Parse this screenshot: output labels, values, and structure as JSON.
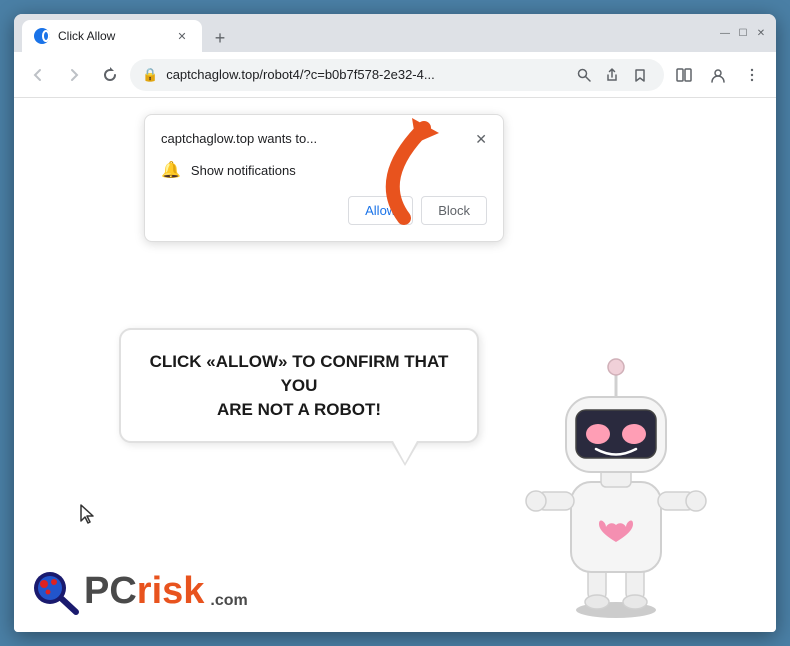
{
  "browser": {
    "tab": {
      "title": "Click Allow",
      "favicon": "globe"
    },
    "new_tab_label": "+",
    "window_controls": {
      "minimize": "—",
      "maximize": "☐",
      "close": "✕"
    },
    "nav": {
      "back_label": "←",
      "forward_label": "→",
      "reload_label": "↺",
      "address": "captchaglow.top/robot4/?c=b0b7f578-2e32-4...",
      "search_icon": "🔍",
      "share_icon": "⎙",
      "bookmark_icon": "☆",
      "split_icon": "▣",
      "profile_icon": "👤",
      "menu_icon": "⋮"
    },
    "notification_popup": {
      "title": "captchaglow.top wants to...",
      "close_label": "✕",
      "notification_text": "Show notifications",
      "allow_label": "Allow",
      "block_label": "Block"
    }
  },
  "page": {
    "bubble_text_line1": "CLICK «ALLOW» TO CONFIRM THAT YOU",
    "bubble_text_line2": "ARE NOT A ROBOT!",
    "logo_text": "PC",
    "logo_risk": "risk",
    "logo_com": ".com",
    "cursor_symbol": "↖"
  },
  "colors": {
    "accent_orange": "#e8531e",
    "browser_chrome_bg": "#dee1e6",
    "nav_bg": "#ffffff",
    "page_bg": "#ffffff",
    "outer_bg": "#4a7fa5"
  }
}
